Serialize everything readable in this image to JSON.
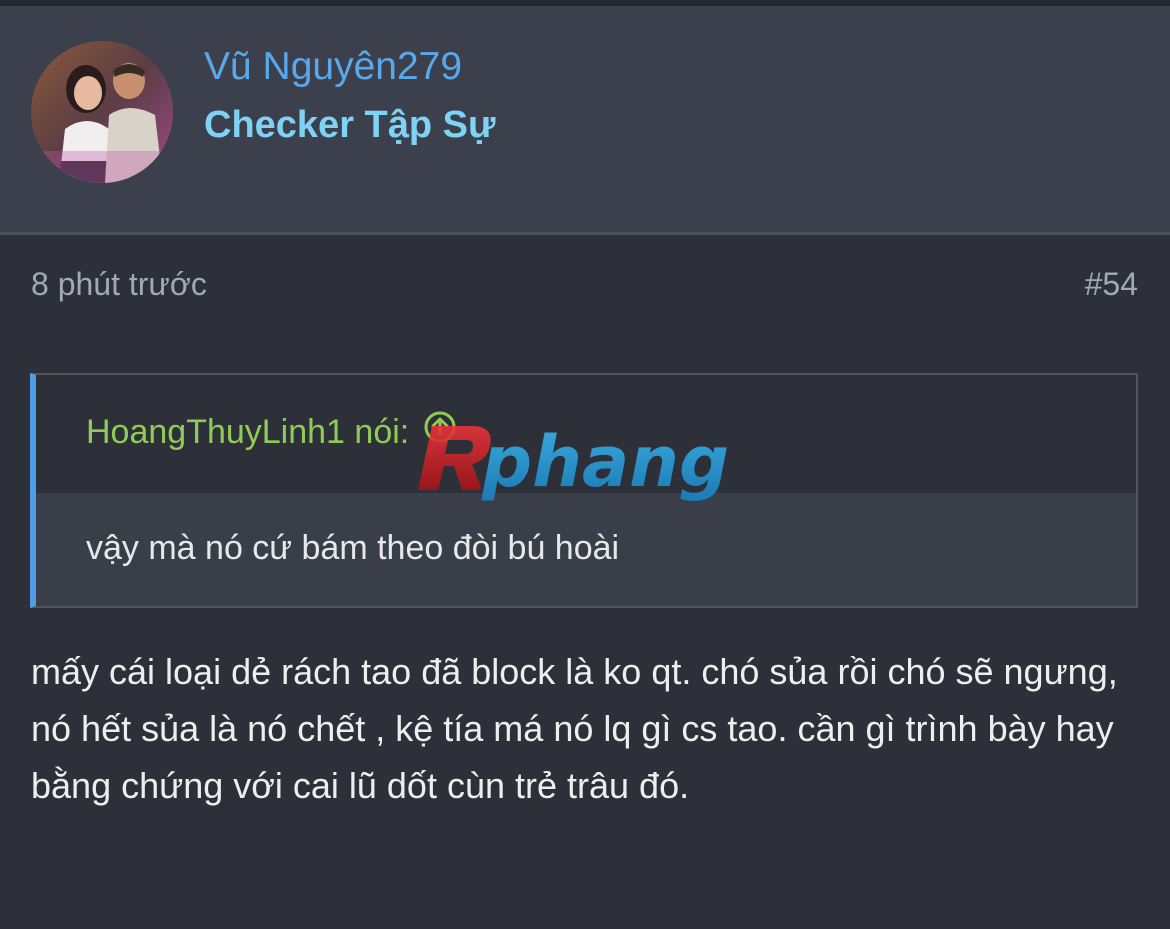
{
  "user": {
    "name": "Vũ Nguyên279",
    "title": "Checker Tập Sự"
  },
  "post": {
    "time": "8 phút trước",
    "number": "#54",
    "quote": {
      "author_label": "HoangThuyLinh1 nói:",
      "text": "vậy mà nó cứ bám theo đòi bú hoài"
    },
    "body": "mấy cái loại dẻ rách tao đã block là ko qt. chó sủa rồi chó sẽ ngưng, nó hết sủa là nó chết , kệ tía má nó lq gì cs tao. cần gì trình bày hay bằng chứng với cai lũ dốt cùn trẻ trâu đó."
  },
  "watermark": {
    "text": "phang"
  },
  "icons": {
    "quote_jump": "arrow-up-circle-icon"
  },
  "colors": {
    "username": "#5aa7ea",
    "user_title": "#7ed3f5",
    "quote_author": "#8fcc55",
    "quote_border": "#4f9ce8",
    "background": "#2d3038"
  }
}
